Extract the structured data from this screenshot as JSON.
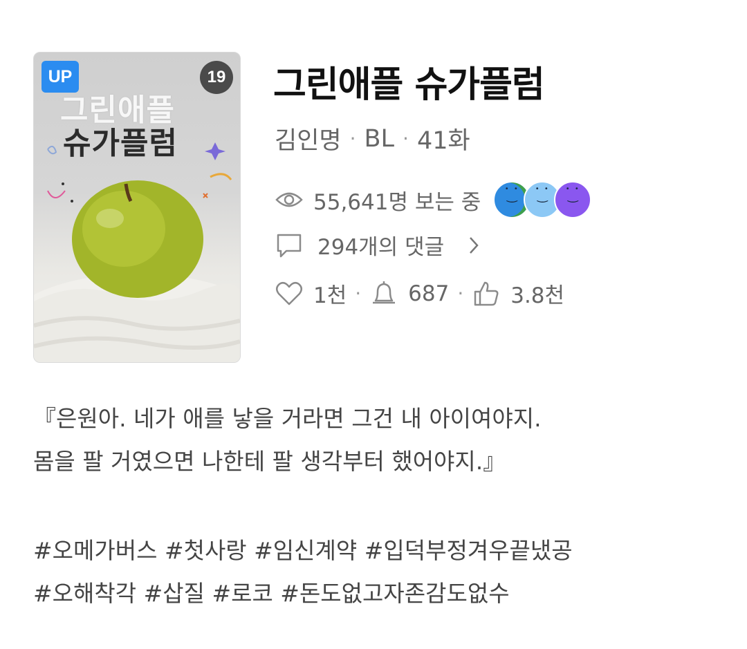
{
  "cover": {
    "update_badge": "UP",
    "age_rating": "19",
    "title_line1": "그린애플",
    "title_line2": "슈가플럼"
  },
  "work": {
    "title": "그린애플 슈가플럼",
    "author": "김인명",
    "genre": "BL",
    "episodes": "41화"
  },
  "stats": {
    "viewers": "55,641명 보는 중",
    "comments": "294개의 댓글",
    "likes": "1천",
    "subscriptions": "687",
    "recommendations": "3.8천"
  },
  "icons": {
    "eye": "eye-icon",
    "comment": "comment-icon",
    "chevron": "chevron-right-icon",
    "heart": "heart-icon",
    "bell": "bell-icon",
    "thumb": "thumbs-up-icon"
  },
  "avatars": [
    {
      "color": "#2f8be0"
    },
    {
      "color": "#8cc8f5"
    },
    {
      "color": "#8a57ef"
    }
  ],
  "description": {
    "line1": "『은원아. 네가 애를 낳을 거라면 그건 내 아이여야지.",
    "line2": "몸을 팔 거였으면 나한테 팔 생각부터 했어야지.』"
  },
  "tags": {
    "line1": "#오메가버스 #첫사랑 #임신계약 #입덕부정겨우끝냈공",
    "line2": "#오해착각 #삽질 #로코 #돈도없고자존감도없수"
  },
  "colors": {
    "accent": "#2b8cf0",
    "text_secondary": "#666666"
  }
}
